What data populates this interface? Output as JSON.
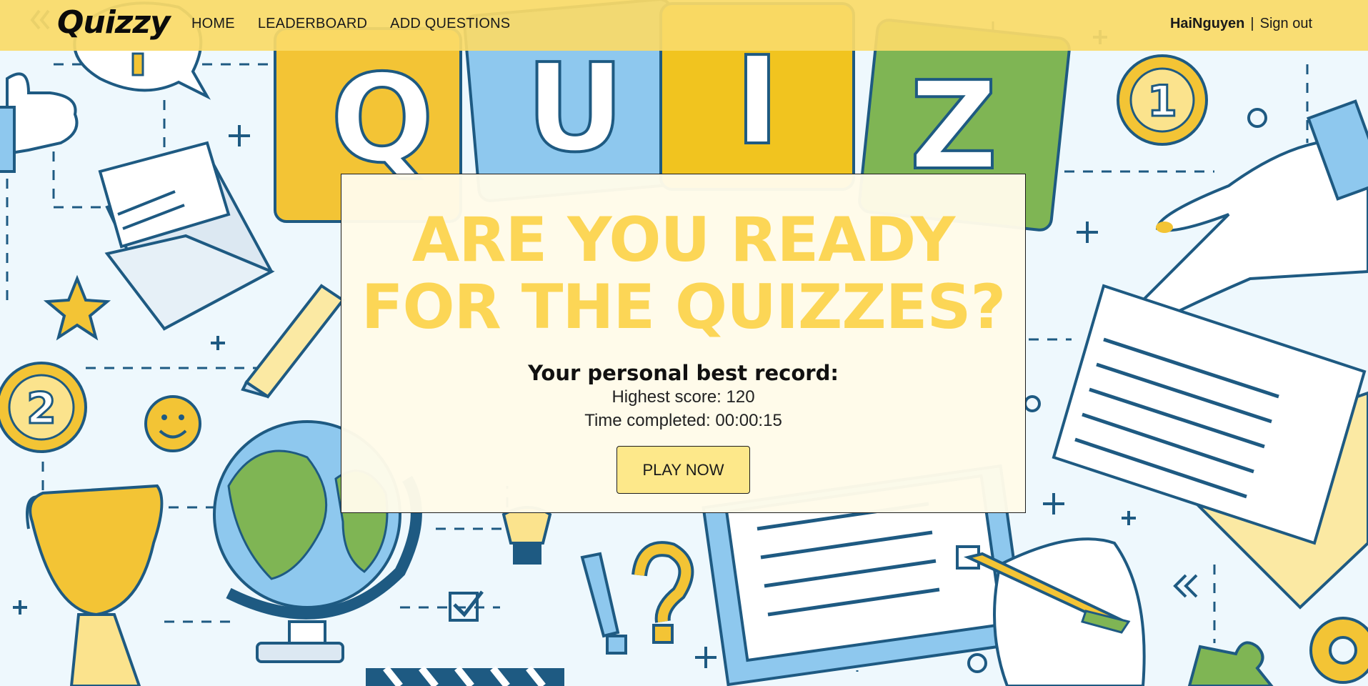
{
  "brand": {
    "logo_text": "Quizzy"
  },
  "nav": {
    "links": [
      {
        "label": "HOME"
      },
      {
        "label": "LEADERBOARD"
      },
      {
        "label": "ADD QUESTIONS"
      }
    ]
  },
  "user": {
    "name": "HaiNguyen",
    "separator": "|",
    "signout_label": "Sign out"
  },
  "background": {
    "tile_letters": [
      "Q",
      "U",
      "I",
      "Z"
    ],
    "medal_1": "1",
    "medal_2": "2"
  },
  "hero": {
    "headline_line1": "ARE YOU READY",
    "headline_line2": "FOR THE QUIZZES?",
    "best_title": "Your personal best record:",
    "score_label": "Highest score:",
    "score_value": "120",
    "time_label": "Time completed:",
    "time_value": "00:00:15",
    "play_label": "PLAY NOW"
  },
  "colors": {
    "nav_bg": "#fad868",
    "headline": "#fcd656",
    "button": "#fde88a",
    "card_bg": "#fffbe9"
  }
}
